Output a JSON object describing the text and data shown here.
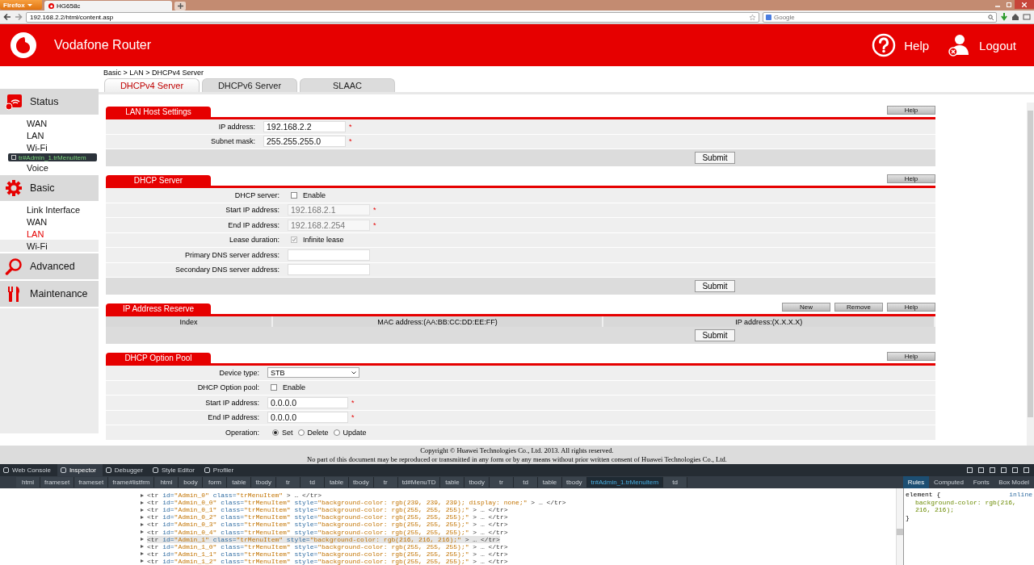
{
  "browser": {
    "menu_button": "Firefox",
    "tabs": [
      {
        "title": "HG658c",
        "selected": true
      }
    ],
    "url": "192.168.2.2/html/content.asp",
    "search": {
      "placeholder": "Google"
    }
  },
  "header": {
    "title": "Vodafone Router",
    "actions": [
      {
        "kind": "help",
        "label": "Help"
      },
      {
        "kind": "logout",
        "label": "Logout"
      }
    ]
  },
  "breadcrumb": "Basic > LAN > DHCPv4 Server",
  "tabs": [
    {
      "label": "DHCPv4 Server",
      "selected": true
    },
    {
      "label": "DHCPv6 Server",
      "selected": false
    },
    {
      "label": "SLAAC",
      "selected": false
    }
  ],
  "sidebar": {
    "groups": [
      {
        "kind": "status",
        "label": "Status",
        "items": [
          {
            "label": "WAN",
            "selected": false,
            "highlighted": false
          },
          {
            "label": "LAN",
            "selected": false,
            "highlighted": false
          },
          {
            "label": "Wi-Fi",
            "selected": false,
            "highlighted": false
          },
          {
            "label": "Voice",
            "selected": false,
            "highlighted": false
          }
        ]
      },
      {
        "kind": "basic",
        "label": "Basic",
        "items": [
          {
            "label": "Link Interface",
            "selected": false,
            "highlighted": false
          },
          {
            "label": "WAN",
            "selected": false,
            "highlighted": false
          },
          {
            "label": "LAN",
            "selected": true,
            "highlighted": false
          },
          {
            "label": "Wi-Fi",
            "selected": false,
            "highlighted": true
          }
        ]
      },
      {
        "kind": "advanced",
        "label": "Advanced"
      },
      {
        "kind": "maintenance",
        "label": "Maintenance"
      }
    ]
  },
  "inspector_tooltip": "tr#Admin_1.trMenuItem",
  "sections": [
    {
      "title": "LAN Host Settings",
      "buttons": [
        "Help"
      ],
      "rows": [
        {
          "kind": "text",
          "label": "IP address:",
          "value": "192.168.2.2",
          "mark": "*",
          "disabled": false
        },
        {
          "kind": "text",
          "label": "Subnet mask:",
          "value": "255.255.255.0",
          "mark": "*",
          "disabled": false
        }
      ],
      "submit": "Submit"
    },
    {
      "title": "DHCP Server",
      "buttons": [
        "Help"
      ],
      "rows": [
        {
          "kind": "checkbox",
          "label": "DHCP server:",
          "option": "Enable",
          "checked": false,
          "disabled": false
        },
        {
          "kind": "text",
          "label": "Start IP address:",
          "value": "192.168.2.1",
          "mark": "*",
          "disabled": true
        },
        {
          "kind": "text",
          "label": "End IP address:",
          "value": "192.168.2.254",
          "mark": "*",
          "disabled": true
        },
        {
          "kind": "checkbox",
          "label": "Lease duration:",
          "option": "Infinite lease",
          "checked": true,
          "disabled": true
        },
        {
          "kind": "text",
          "label": "Primary DNS server address:"
        },
        {
          "kind": "text",
          "label": "Secondary DNS server address:"
        }
      ],
      "submit": "Submit"
    },
    {
      "title": "IP Address Reserve",
      "buttons": [
        "New",
        "Remove",
        "Help"
      ],
      "columns": [
        "Index",
        "MAC address:(AA:BB:CC:DD:EE:FF)",
        "IP address:(X.X.X.X)"
      ],
      "submit": "Submit"
    },
    {
      "title": "DHCP Option Pool",
      "buttons": [
        "Help"
      ],
      "rows": [
        {
          "kind": "select",
          "label": "Device type:",
          "value": "STB"
        },
        {
          "kind": "checkbox",
          "label": "DHCP Option pool:",
          "option": "Enable",
          "checked": false,
          "disabled": false
        },
        {
          "kind": "text",
          "label": "Start IP address:",
          "value": "0.0.0.0",
          "mark": "*",
          "disabled": false
        },
        {
          "kind": "text",
          "label": "End IP address:",
          "value": "0.0.0.0",
          "mark": "*",
          "disabled": false
        },
        {
          "kind": "radio",
          "label": "Operation:",
          "options": [
            {
              "label": "Set",
              "selected": true
            },
            {
              "label": "Delete",
              "selected": false
            },
            {
              "label": "Update",
              "selected": false
            }
          ]
        }
      ]
    }
  ],
  "footer": [
    "Copyright © Huawei Technologies Co., Ltd. 2013. All rights reserved.",
    "No part of this document may be reproduced or transmitted in any form or by any means without prior written consent of Huawei Technologies Co., Ltd."
  ],
  "devtools": {
    "tabs": [
      {
        "label": "Web Console",
        "selected": false
      },
      {
        "label": "Inspector",
        "selected": true
      },
      {
        "label": "Debugger",
        "selected": false
      },
      {
        "label": "Style Editor",
        "selected": false
      },
      {
        "label": "Profiler",
        "selected": false
      }
    ],
    "breadcrumb": [
      {
        "label": "html",
        "selected": false
      },
      {
        "label": "frameset",
        "selected": false
      },
      {
        "label": "frameset",
        "selected": false
      },
      {
        "label": "frame#listfrm",
        "selected": false
      },
      {
        "label": "html",
        "selected": false
      },
      {
        "label": "body",
        "selected": false
      },
      {
        "label": "form",
        "selected": false
      },
      {
        "label": "table",
        "selected": false
      },
      {
        "label": "tbody",
        "selected": false
      },
      {
        "label": "tr",
        "selected": false
      },
      {
        "label": "td",
        "selected": false
      },
      {
        "label": "table",
        "selected": false
      },
      {
        "label": "tbody",
        "selected": false
      },
      {
        "label": "tr",
        "selected": false
      },
      {
        "label": "td#MenuTD",
        "selected": false
      },
      {
        "label": "table",
        "selected": false
      },
      {
        "label": "tbody",
        "selected": false
      },
      {
        "label": "tr",
        "selected": false
      },
      {
        "label": "td",
        "selected": false
      },
      {
        "label": "table",
        "selected": false
      },
      {
        "label": "tbody",
        "selected": false
      },
      {
        "label": "tr#Admin_1.trMenuItem",
        "selected": true
      },
      {
        "label": "td",
        "selected": false
      }
    ],
    "side_tabs": [
      {
        "label": "Rules",
        "selected": true
      },
      {
        "label": "Computed",
        "selected": false
      },
      {
        "label": "Fonts",
        "selected": false
      },
      {
        "label": "Box Model",
        "selected": false
      }
    ],
    "markup": [
      {
        "text": "<tr id=\"Admin_0\" class=\"trMenuItem\" > … </tr>",
        "selected": false
      },
      {
        "text": "<tr id=\"Admin_0_0\" class=\"trMenuItem\" style=\"background-color: rgb(239, 239, 239); display: none;\" > … </tr>",
        "selected": false
      },
      {
        "text": "<tr id=\"Admin_0_1\" class=\"trMenuItem\" style=\"background-color: rgb(255, 255, 255);\" > … </tr>",
        "selected": false
      },
      {
        "text": "<tr id=\"Admin_0_2\" class=\"trMenuItem\" style=\"background-color: rgb(255, 255, 255);\" > … </tr>",
        "selected": false
      },
      {
        "text": "<tr id=\"Admin_0_3\" class=\"trMenuItem\" style=\"background-color: rgb(255, 255, 255);\" > … </tr>",
        "selected": false
      },
      {
        "text": "<tr id=\"Admin_0_4\" class=\"trMenuItem\" style=\"background-color: rgb(255, 255, 255);\" > … </tr>",
        "selected": false
      },
      {
        "text": "<tr id=\"Admin_1\" class=\"trMenuItem\" style=\"background-color: rgb(216, 216, 216);\" > … </tr>",
        "selected": true
      },
      {
        "text": "<tr id=\"Admin_1_0\" class=\"trMenuItem\" style=\"background-color: rgb(255, 255, 255);\" > … </tr>",
        "selected": false
      },
      {
        "text": "<tr id=\"Admin_1_1\" class=\"trMenuItem\" style=\"background-color: rgb(255, 255, 255);\" > … </tr>",
        "selected": false
      },
      {
        "text": "<tr id=\"Admin_1_2\" class=\"trMenuItem\" style=\"background-color: rgb(255, 255, 255);\" > … </tr>",
        "selected": false
      }
    ],
    "rules": {
      "selector": "element {",
      "declaration": "background-color: rgb(216, 216, 216);",
      "close": "}",
      "source": "inline"
    }
  }
}
